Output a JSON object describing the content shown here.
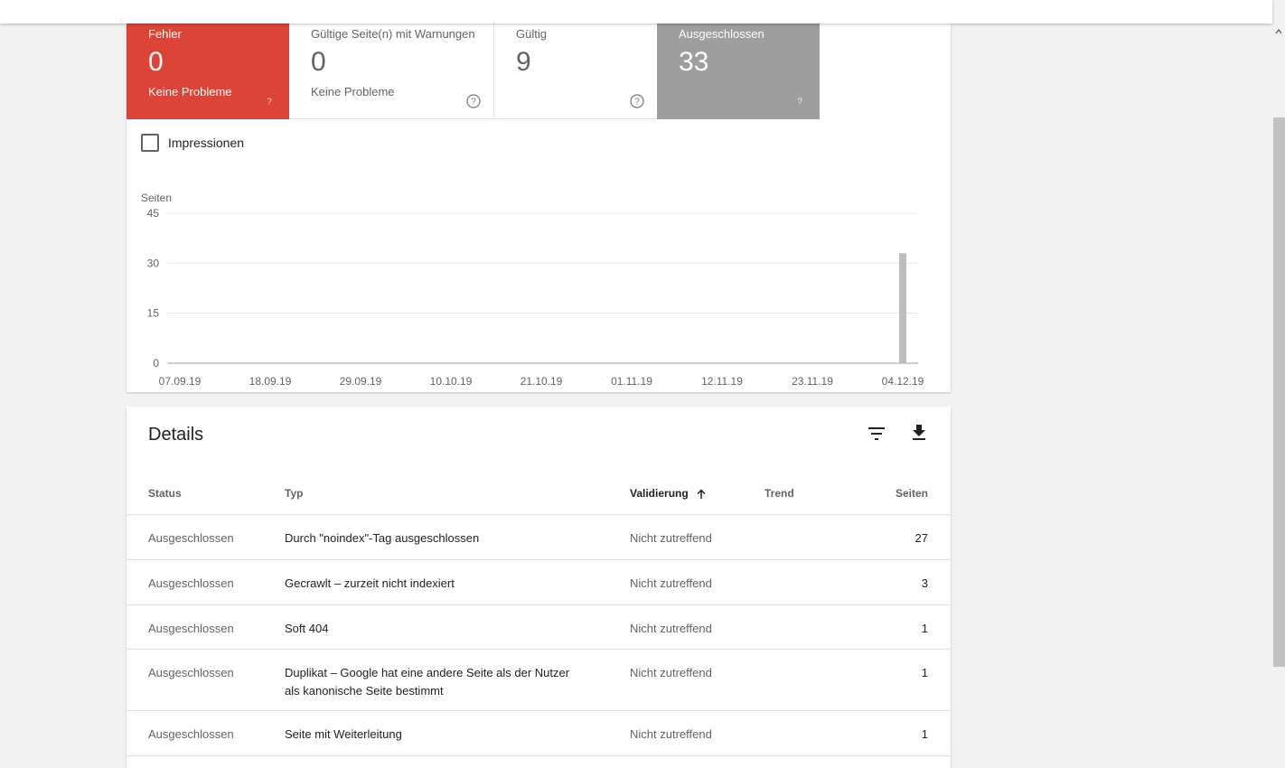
{
  "summary": {
    "error": {
      "label": "Fehler",
      "value": "0",
      "sub": "Keine Probleme"
    },
    "warnings": {
      "label": "Gültige Seite(n) mit Warnungen",
      "value": "0",
      "sub": "Keine Probleme"
    },
    "valid": {
      "label": "Gültig",
      "value": "9"
    },
    "excluded": {
      "label": "Ausgeschlossen",
      "value": "33"
    }
  },
  "impressions": {
    "label": "Impressionen",
    "checked": false
  },
  "chart_data": {
    "type": "bar",
    "ylabel": "Seiten",
    "ylim": [
      0,
      45
    ],
    "yticks": [
      "45",
      "30",
      "15",
      "0"
    ],
    "xticks": [
      "07.09.19",
      "18.09.19",
      "29.09.19",
      "10.10.19",
      "21.10.19",
      "01.11.19",
      "12.11.19",
      "23.11.19",
      "04.12.19"
    ],
    "series": [
      {
        "color": "#bdbdbd",
        "points": [
          {
            "x": "04.12.19",
            "y": 33
          }
        ]
      }
    ],
    "grid": true
  },
  "details": {
    "title": "Details",
    "columns": {
      "status": "Status",
      "type": "Typ",
      "validation": "Validierung",
      "trend": "Trend",
      "pages": "Seiten"
    },
    "rows": [
      {
        "status": "Ausgeschlossen",
        "type": "Durch \"noindex\"-Tag ausgeschlossen",
        "validation": "Nicht zutreffend",
        "pages": "27"
      },
      {
        "status": "Ausgeschlossen",
        "type": "Gecrawlt – zurzeit nicht indexiert",
        "validation": "Nicht zutreffend",
        "pages": "3"
      },
      {
        "status": "Ausgeschlossen",
        "type": "Soft 404",
        "validation": "Nicht zutreffend",
        "pages": "1"
      },
      {
        "status": "Ausgeschlossen",
        "type": "Duplikat – Google hat eine andere Seite als der Nutzer als kanonische Seite bestimmt",
        "validation": "Nicht zutreffend",
        "pages": "1"
      },
      {
        "status": "Ausgeschlossen",
        "type": "Seite mit Weiterleitung",
        "validation": "Nicht zutreffend",
        "pages": "1"
      }
    ]
  },
  "colors": {
    "error": "#db4437",
    "excluded": "#9e9e9e",
    "bar": "#bdbdbd"
  },
  "icons": {
    "help": "help-circle-icon",
    "filter": "filter-icon",
    "download": "download-icon",
    "sort": "arrow-up-icon"
  }
}
